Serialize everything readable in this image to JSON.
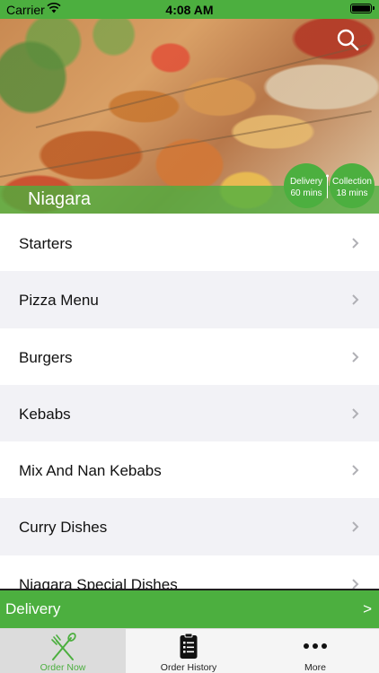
{
  "status_bar": {
    "carrier": "Carrier",
    "time": "4:08 AM"
  },
  "restaurant": {
    "name": "Niagara"
  },
  "badges": {
    "delivery": {
      "label": "Delivery",
      "time": "60 mins"
    },
    "collection": {
      "label": "Collection",
      "time": "18 mins"
    }
  },
  "categories": [
    "Starters",
    "Pizza Menu",
    "Burgers",
    "Kebabs",
    "Mix And Nan Kebabs",
    "Curry Dishes",
    "Niagara Special Dishes"
  ],
  "delivery_bar": {
    "label": "Delivery",
    "arrow": ">"
  },
  "tabs": [
    {
      "label": "Order Now",
      "icon": "fork-knife-icon",
      "active": true
    },
    {
      "label": "Order History",
      "icon": "clipboard-list-icon",
      "active": false
    },
    {
      "label": "More",
      "icon": "ellipsis-icon",
      "active": false
    }
  ],
  "colors": {
    "accent": "#4caf3f",
    "list_alt": "#f2f2f6",
    "tab_active_bg": "#dcdcdc"
  }
}
